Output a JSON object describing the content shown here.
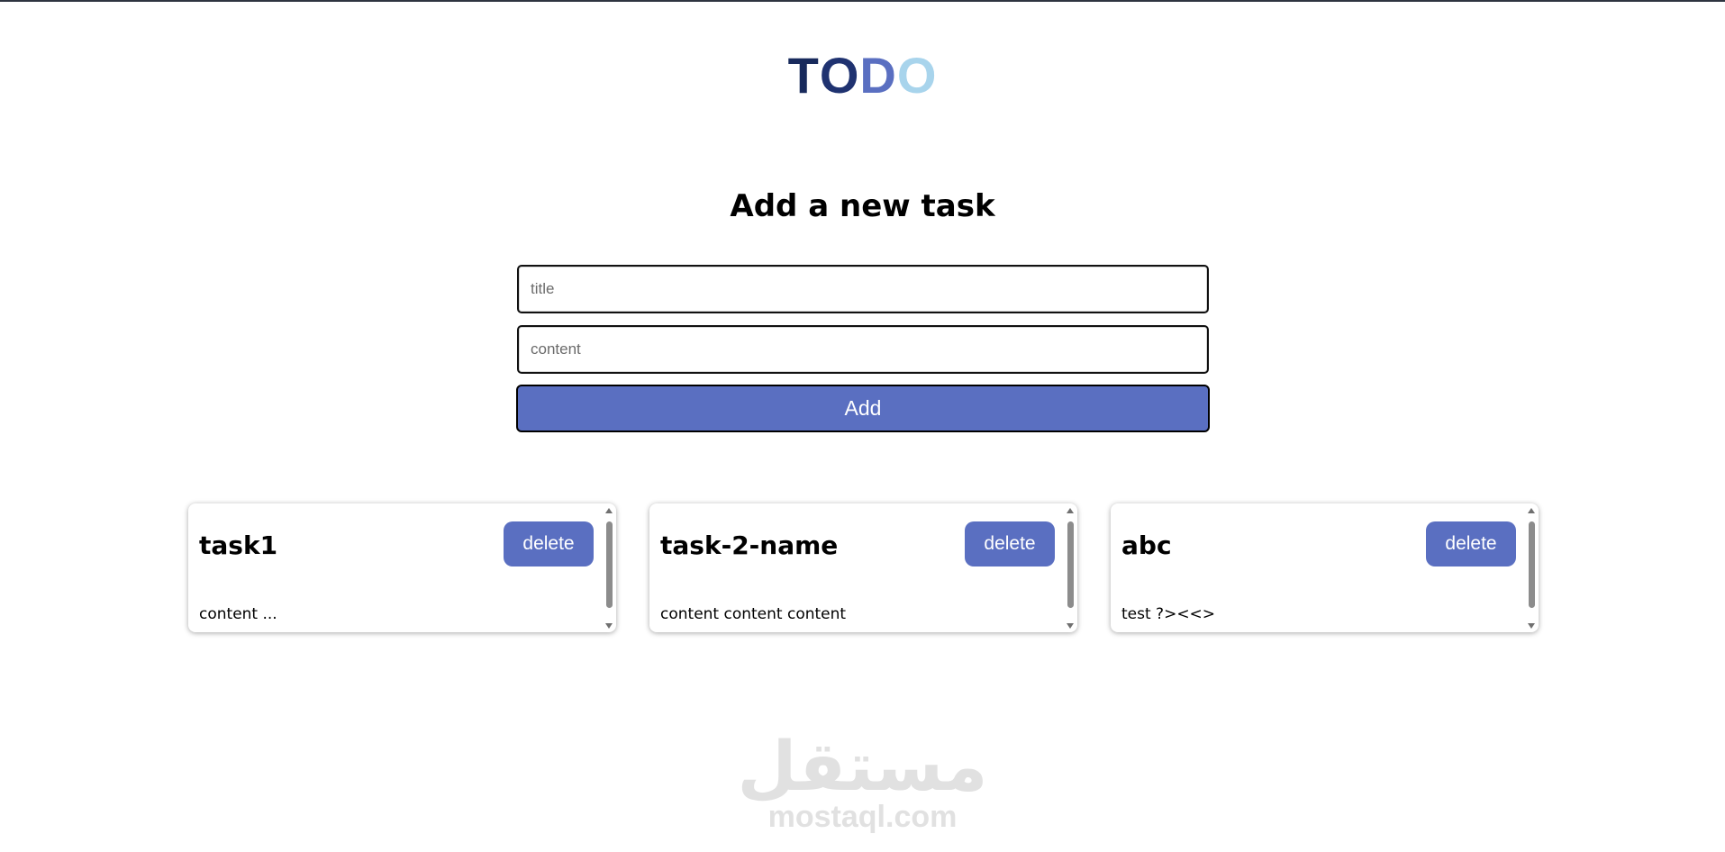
{
  "logo": {
    "letters": [
      {
        "char": "T",
        "color": "#182a5c"
      },
      {
        "char": "O",
        "color": "#1f3270"
      },
      {
        "char": "D",
        "color": "#5a6fc1"
      },
      {
        "char": "O",
        "color": "#a8d4ec"
      }
    ]
  },
  "form": {
    "heading": "Add a new task",
    "title_placeholder": "title",
    "content_placeholder": "content",
    "add_label": "Add"
  },
  "tasks": [
    {
      "title": "task1",
      "content": "content ...",
      "delete_label": "delete"
    },
    {
      "title": "task-2-name",
      "content": "content content content",
      "delete_label": "delete"
    },
    {
      "title": "abc",
      "content": "test ?><<>",
      "delete_label": "delete"
    }
  ],
  "watermark": {
    "arabic": "مستقل",
    "latin": "mostaql.com"
  },
  "colors": {
    "accent": "#5a6fc1",
    "logo_dark": "#182a5c",
    "logo_light": "#a8d4ec",
    "watermark": "#e1e1e1"
  },
  "icons": {
    "scroll_up": "triangle-up-icon",
    "scroll_down": "triangle-down-icon"
  }
}
